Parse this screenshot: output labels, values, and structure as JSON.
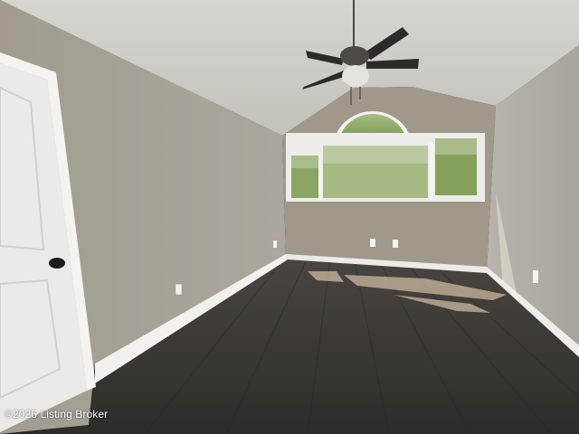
{
  "photo": {
    "subject": "empty-bedroom-vaulted-ceiling",
    "watermark_text": "©2026 Listing Broker"
  },
  "colors": {
    "ceiling": "#cfcdc8",
    "left_wall": "#a8a397",
    "back_wall": "#9f998c",
    "right_wall": "#b3afa7",
    "floor": "#3a3632",
    "trim": "#f2f1ee",
    "door": "#ebeae6",
    "foliage": "#7e9a55"
  },
  "icons": {
    "ceiling_fan": "ceiling-fan-icon",
    "door_knob": "door-knob-icon",
    "outlet": "outlet-icon"
  }
}
